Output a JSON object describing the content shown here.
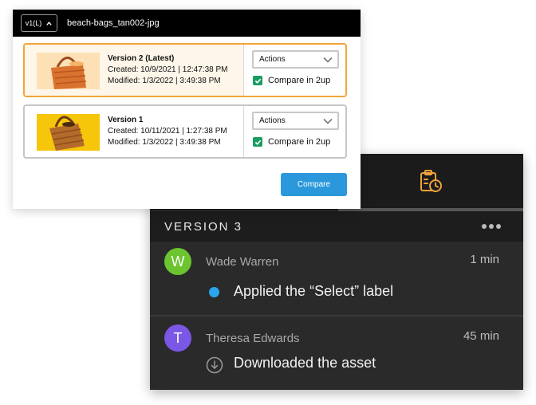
{
  "versions_panel": {
    "version_selector": "v1(L)",
    "filename": "beach-bags_tan002-jpg",
    "versions": [
      {
        "name": "Version 2 (Latest)",
        "created": "Created: 10/9/2021 | 12:47:38 PM",
        "modified": "Modified: 1/3/2022 | 3:49:38 PM",
        "actions_label": "Actions",
        "compare_label": "Compare in 2up",
        "compare_checked": true,
        "highlight_color": "#f2a53a"
      },
      {
        "name": "Version 1",
        "created": "Created: 10/11/2021 | 1:27:38 PM",
        "modified": "Modified: 1/3/2022 | 3:49:38 PM",
        "actions_label": "Actions",
        "compare_label": "Compare in 2up",
        "compare_checked": true
      }
    ],
    "compare_button": "Compare",
    "accent_color": "#2b98db",
    "checkbox_color": "#1b9c61"
  },
  "activity_panel": {
    "tab_icon": "version-history-icon",
    "tab_icon_color": "#f0a23a",
    "section_title": "VERSION 3",
    "items": [
      {
        "avatar_letter": "W",
        "avatar_color": "#6cc42e",
        "user": "Wade Warren",
        "time": "1 min",
        "icon": "status-dot-icon",
        "text": "Applied the “Select” label"
      },
      {
        "avatar_letter": "T",
        "avatar_color": "#7b57e6",
        "user": "Theresa Edwards",
        "time": "45 min",
        "icon": "download-icon",
        "text": "Downloaded the asset"
      }
    ]
  }
}
